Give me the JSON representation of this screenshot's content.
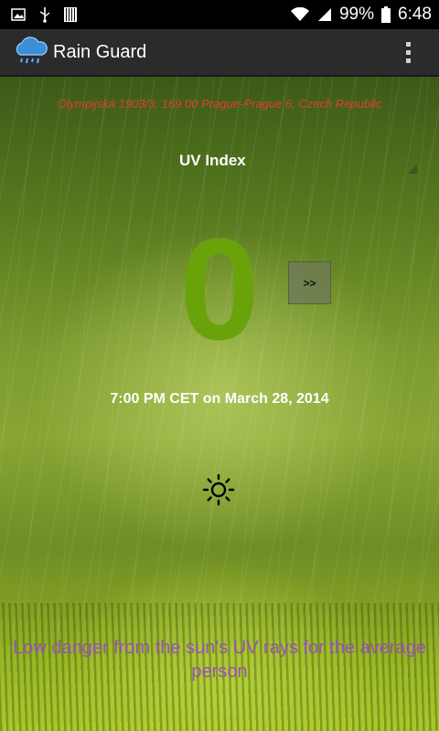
{
  "status_bar": {
    "battery": "99%",
    "time": "6:48",
    "icons": [
      "image-icon",
      "usb-icon",
      "barcode-icon",
      "wifi-icon",
      "signal-icon",
      "battery-icon"
    ]
  },
  "app": {
    "title": "Rain Guard",
    "icon": "rain-cloud-icon",
    "menu_icon": "overflow-menu-icon"
  },
  "main": {
    "address": "Olympijská 1903/3, 169 00 Prague-Prague 6, Czech Republic",
    "selector_label": "UV Index",
    "uv_value": "0",
    "next_label": ">>",
    "timestamp": "7:00 PM CET on March 28, 2014",
    "weather_icon": "sun-icon",
    "danger_text": "Low danger from the sun's UV rays for the average person"
  },
  "colors": {
    "uv_value": "#6aa20c",
    "address": "#e0402a",
    "danger_text": "#9a4fbf",
    "action_bar": "#2b2b2b"
  }
}
